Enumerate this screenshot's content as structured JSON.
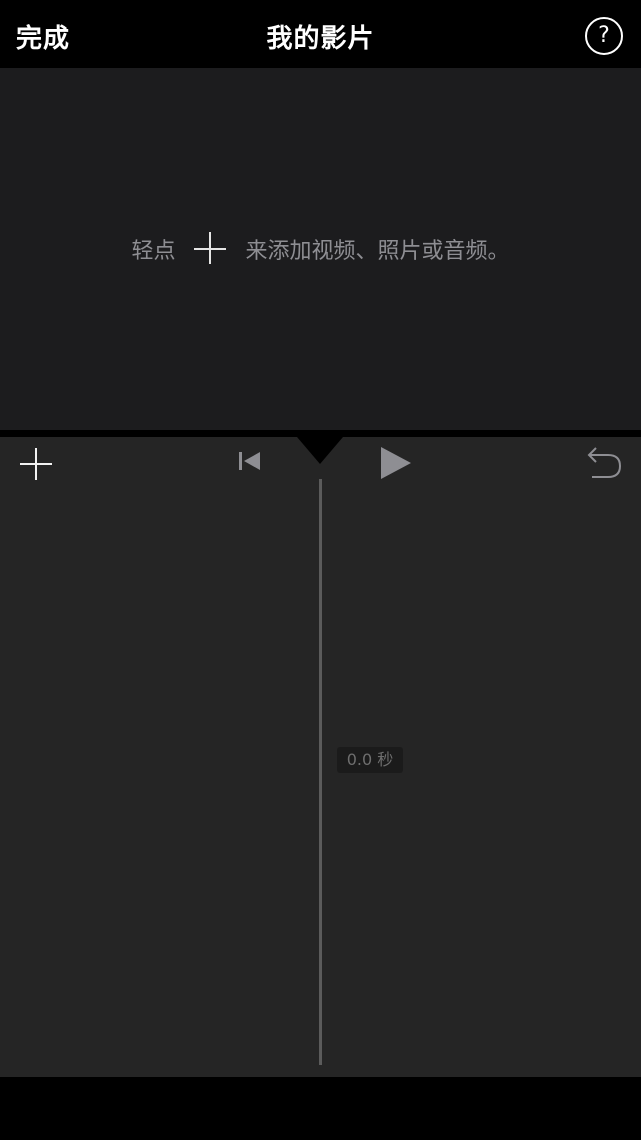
{
  "nav": {
    "done_label": "完成",
    "title": "我的影片",
    "help_label": "?"
  },
  "viewer": {
    "hint_before": "轻点",
    "hint_after": "来添加视频、照片或音频。"
  },
  "timeline": {
    "duration": "0.0 秒"
  },
  "icons": {
    "add": "plus-icon",
    "skip_start": "skip-to-start-icon",
    "play": "play-icon",
    "undo": "undo-icon"
  },
  "colors": {
    "background": "#000000",
    "viewer": "#1c1c1e",
    "timeline": "#252525",
    "hint_text": "#8e8e93"
  }
}
